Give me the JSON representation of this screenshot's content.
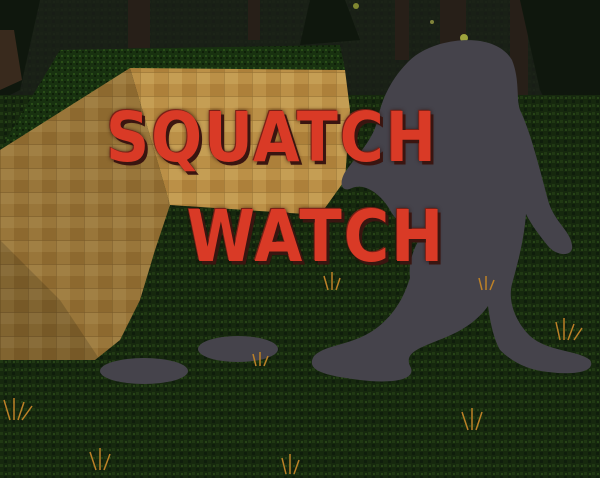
{
  "title": {
    "line1": "SQUATCH",
    "line2": "WATCH"
  },
  "colors": {
    "title_red": "#d93a26",
    "silhouette": "#4a4850",
    "grass": "#1f3a14",
    "wood": "#c99e4e"
  }
}
